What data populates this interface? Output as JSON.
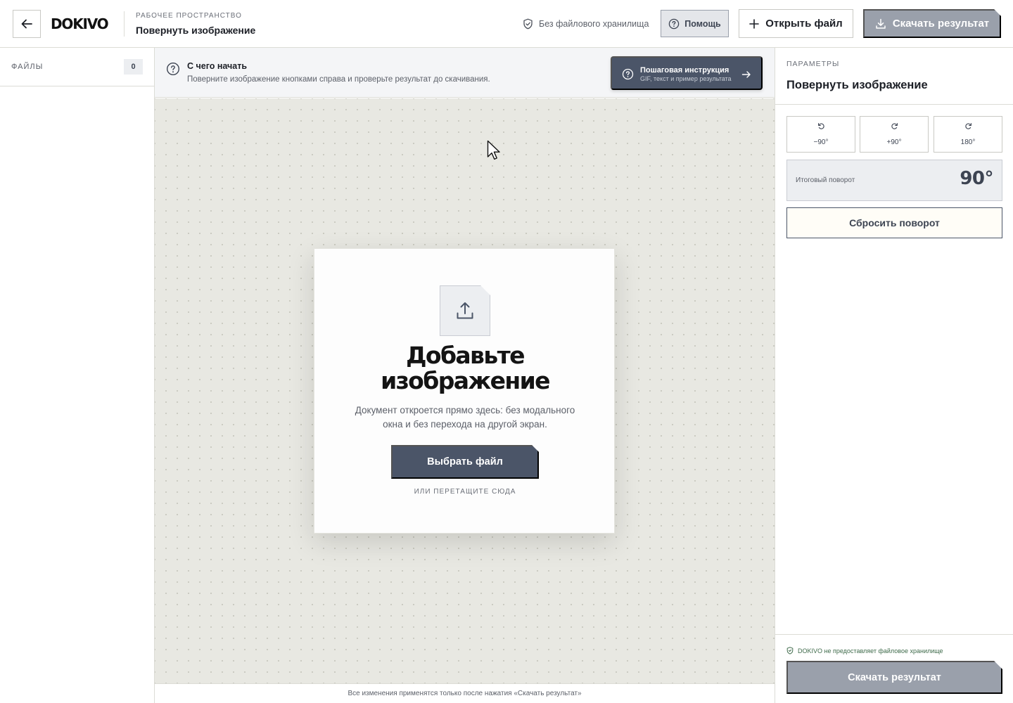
{
  "header": {
    "logo": "DOKIVO",
    "workspace_caption": "РАБОЧЕЕ ПРОСТРАНСТВО",
    "workspace_title": "Повернуть изображение",
    "storage_note": "Без файлового хранилища",
    "help_label": "Помощь",
    "open_file_label": "Открыть файл",
    "download_label": "Скачать результат",
    "download_disabled": true
  },
  "sidebar": {
    "files_label": "ФАЙЛЫ",
    "files_count": "0"
  },
  "info_bar": {
    "title": "С чего начать",
    "text": "Поверните изображение кнопками справа и проверьте результат до скачивания.",
    "guide_title": "Пошаговая инструкция",
    "guide_subtitle": "GIF, текст и пример результата"
  },
  "upload": {
    "heading_line1": "Добавьте",
    "heading_line2": "изображение",
    "description_line1": "Документ откроется прямо здесь: без модального",
    "description_line2": "окна и без перехода на другой экран.",
    "choose_label": "Выбрать файл",
    "drop_hint": "ИЛИ ПЕРЕТАЩИТЕ СЮДА"
  },
  "bottom_note": "Все изменения применятся только после нажатия «Скачать результат»",
  "params": {
    "caption": "ПАРАМЕТРЫ",
    "title": "Повернуть изображение",
    "rotate_buttons": [
      {
        "label": "−90°",
        "icon": "rotate-ccw-icon"
      },
      {
        "label": "+90°",
        "icon": "rotate-cw-icon"
      },
      {
        "label": "180°",
        "icon": "rotate-cw-icon"
      }
    ],
    "total_label": "Итоговый поворот",
    "total_value": "90°",
    "reset_label": "Сбросить поворот",
    "footer_note": "DOKIVO не предоставляет файловое хранилище",
    "download_label": "Скачать результат"
  },
  "colors": {
    "accent": "#4b5568",
    "disabled": "#9aa0ab",
    "canvas_bg": "#e8e8e2",
    "panel_bg": "#ffffff",
    "success_text": "#3f6b4b"
  }
}
